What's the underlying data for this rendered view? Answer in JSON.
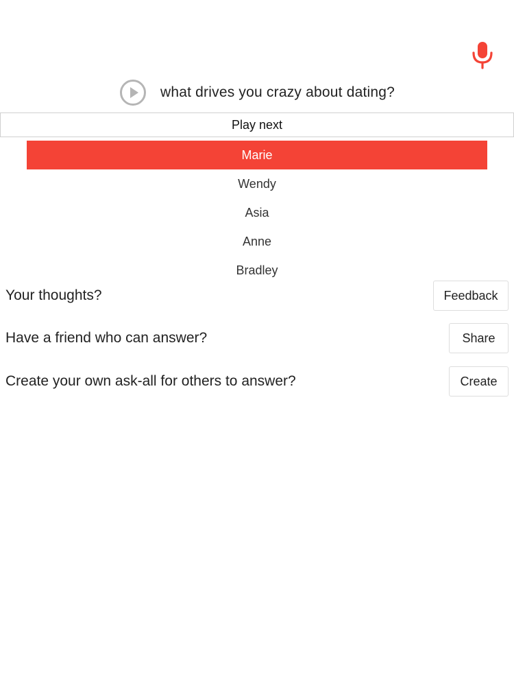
{
  "header": {
    "mic_icon": "microphone-icon",
    "accent_color": "#f44336"
  },
  "question": {
    "play_icon": "play-circle-icon",
    "text": "what drives you crazy about dating?"
  },
  "play_next": {
    "label": "Play next"
  },
  "queue": {
    "selected_index": 0,
    "items": [
      {
        "name": "Marie"
      },
      {
        "name": "Wendy"
      },
      {
        "name": "Asia"
      },
      {
        "name": "Anne"
      },
      {
        "name": "Bradley"
      }
    ]
  },
  "actions": [
    {
      "prompt": "Your thoughts?",
      "button_label": "Feedback"
    },
    {
      "prompt": "Have a friend who can answer?",
      "button_label": "Share"
    },
    {
      "prompt": "Create your own ask-all for others to answer?",
      "button_label": "Create"
    }
  ]
}
